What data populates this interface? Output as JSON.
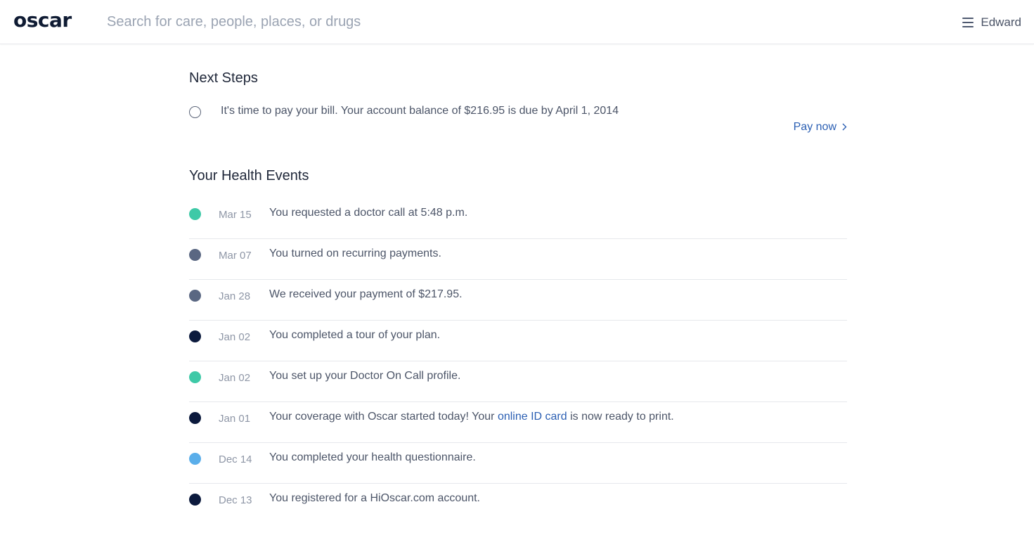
{
  "header": {
    "logo": "oscar",
    "search_placeholder": "Search for care, people, places, or drugs",
    "menu_icon": "hamburger-icon",
    "user_name": "Edward"
  },
  "next_steps": {
    "title": "Next Steps",
    "item_text": "It's time to pay your bill. Your account balance of $216.95 is due by April 1, 2014",
    "pay_label": "Pay now",
    "pay_icon": "chevron-right-icon"
  },
  "events": {
    "title": "Your Health Events",
    "colors": {
      "teal": "#3ec9a7",
      "slate": "#5a6782",
      "navy": "#0c1a3d",
      "blue": "#5aaeea"
    },
    "items": [
      {
        "date": "Mar 15",
        "text": "You requested a doctor call at 5:48 p.m.",
        "color": "#3ec9a7"
      },
      {
        "date": "Mar 07",
        "text": "You turned on recurring payments.",
        "color": "#5a6782"
      },
      {
        "date": "Jan 28",
        "text": "We received your payment of $217.95.",
        "color": "#5a6782"
      },
      {
        "date": "Jan 02",
        "text": "You completed a tour of your plan.",
        "color": "#0c1a3d"
      },
      {
        "date": "Jan 02",
        "text": "You set up your Doctor On Call profile.",
        "color": "#3ec9a7"
      },
      {
        "date": "Jan 01",
        "text_before": "Your coverage with Oscar started today! Your ",
        "link": "online ID card",
        "text_after": " is now ready to print.",
        "color": "#0c1a3d"
      },
      {
        "date": "Dec 14",
        "text": "You completed your health questionnaire.",
        "color": "#5aaeea"
      },
      {
        "date": "Dec 13",
        "text": "You registered for a HiOscar.com account.",
        "color": "#0c1a3d"
      }
    ]
  }
}
